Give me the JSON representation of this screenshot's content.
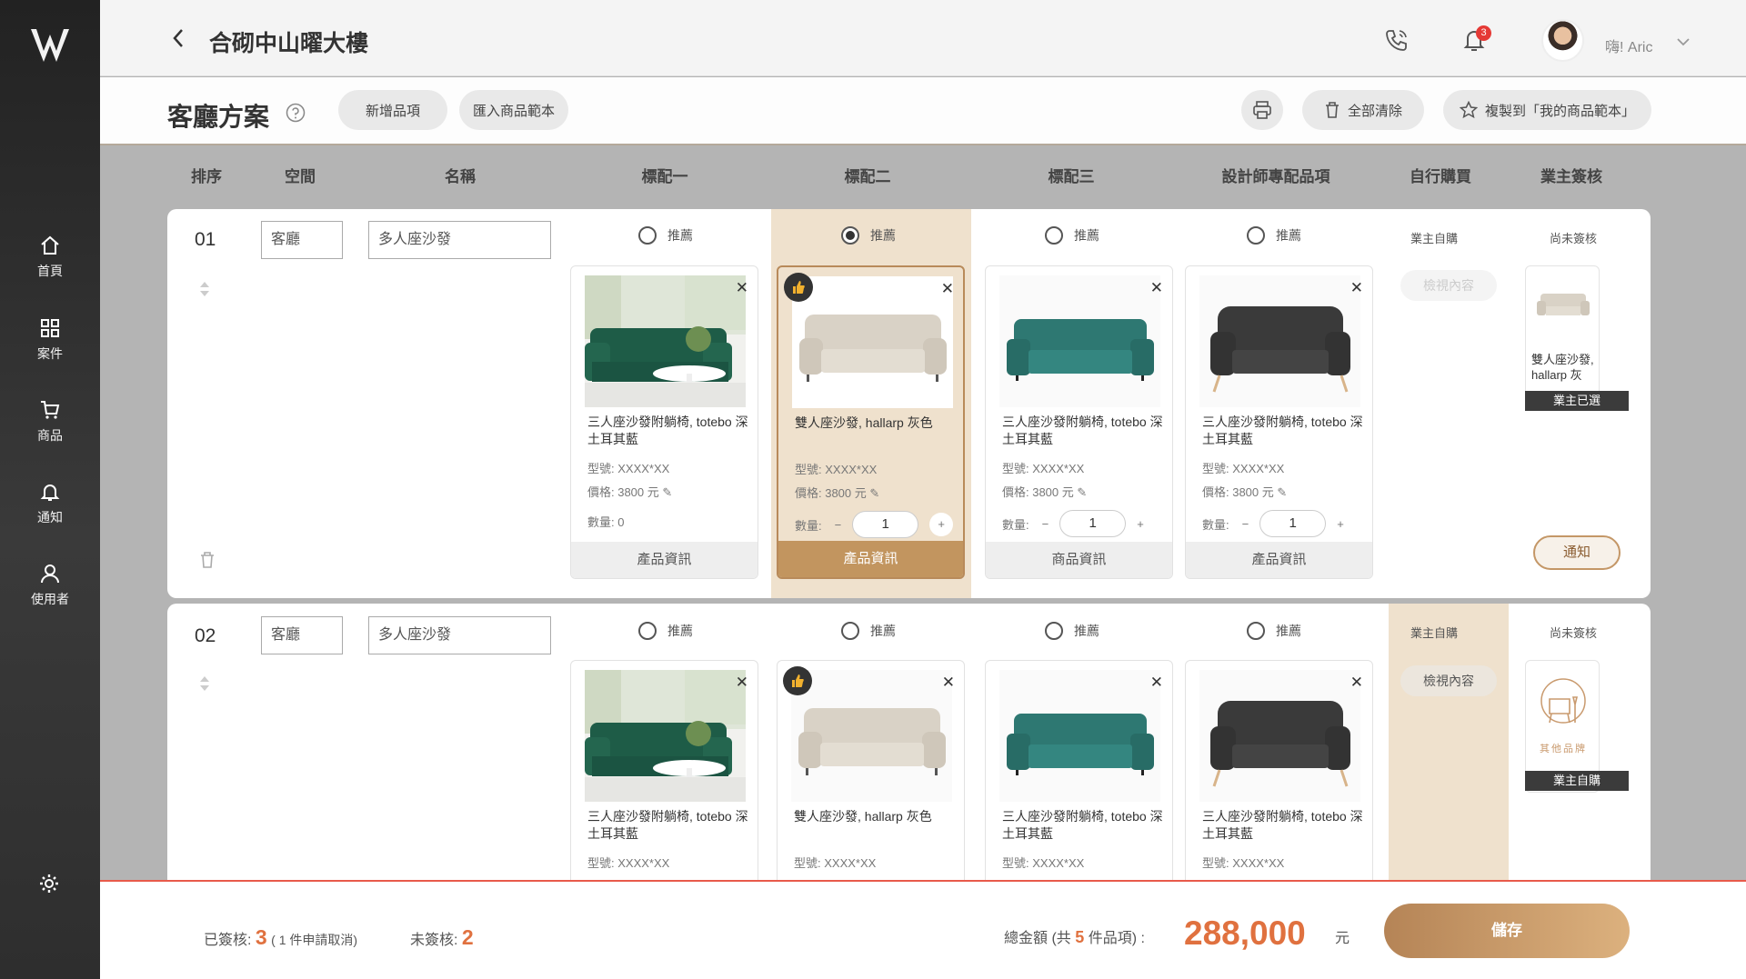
{
  "header": {
    "project_title": "合砌中山曜大樓",
    "greeting": "嗨! Aric",
    "notification_count": "3"
  },
  "nav": {
    "items": [
      {
        "label": "首頁",
        "icon": "home-icon"
      },
      {
        "label": "案件",
        "icon": "grid-icon"
      },
      {
        "label": "商品",
        "icon": "cart-icon"
      },
      {
        "label": "通知",
        "icon": "bell-icon"
      },
      {
        "label": "使用者",
        "icon": "user-icon"
      }
    ]
  },
  "toolbar": {
    "page_title": "客廳方案",
    "add_item": "新增品項",
    "import_template": "匯入商品範本",
    "clear_all": "全部清除",
    "copy_template": "複製到「我的商品範本」"
  },
  "columns": [
    "排序",
    "空間",
    "名稱",
    "標配一",
    "標配二",
    "標配三",
    "設計師專配品項",
    "自行購買",
    "業主簽核"
  ],
  "rows": [
    {
      "index": "01",
      "space": "客廳",
      "name": "多人座沙發",
      "self_buy": "業主自購",
      "view_content": "檢視內容",
      "approval": "尚未簽核",
      "owner_card_name": "雙人座沙發, hallarp 灰色...",
      "owner_tag": "業主已選",
      "notify_label": "通知",
      "products": [
        {
          "recommend": "推薦",
          "name": "三人座沙發附躺椅, totebo 深土耳其藍",
          "model": "型號: XXXX*XX",
          "price": "價格: 3800 元",
          "qty_label": "數量:",
          "qty": "0",
          "footer": "產品資訊"
        },
        {
          "recommend": "推薦",
          "name": "雙人座沙發, hallarp 灰色",
          "model": "型號: XXXX*XX",
          "price": "價格: 3800 元",
          "qty_label": "數量:",
          "qty": "1",
          "footer": "產品資訊"
        },
        {
          "recommend": "推薦",
          "name": "三人座沙發附躺椅, totebo 深土耳其藍",
          "model": "型號: XXXX*XX",
          "price": "價格: 3800 元",
          "qty_label": "數量:",
          "qty": "1",
          "footer": "商品資訊"
        },
        {
          "recommend": "推薦",
          "name": "三人座沙發附躺椅, totebo 深土耳其藍",
          "model": "型號: XXXX*XX",
          "price": "價格: 3800 元",
          "qty_label": "數量:",
          "qty": "1",
          "footer": "產品資訊"
        }
      ]
    },
    {
      "index": "02",
      "space": "客廳",
      "name": "多人座沙發",
      "self_buy": "業主自購",
      "view_content": "檢視內容",
      "approval": "尚未簽核",
      "other_brand": "其他品牌",
      "owner_tag": "業主自購",
      "products": [
        {
          "recommend": "推薦",
          "name": "三人座沙發附躺椅, totebo 深土耳其藍",
          "model": "型號: XXXX*XX"
        },
        {
          "recommend": "推薦",
          "name": "雙人座沙發, hallarp 灰色",
          "model": "型號: XXXX*XX"
        },
        {
          "recommend": "推薦",
          "name": "三人座沙發附躺椅, totebo 深土耳其藍",
          "model": "型號: XXXX*XX"
        },
        {
          "recommend": "推薦",
          "name": "三人座沙發附躺椅, totebo 深土耳其藍",
          "model": "型號: XXXX*XX"
        }
      ]
    }
  ],
  "footer": {
    "signed_label": "已簽核:",
    "signed_count": "3",
    "cancel_note": "( 1 件申請取消)",
    "unsigned_label": "未簽核:",
    "unsigned_count": "2",
    "total_prefix": "總金額 (共",
    "item_count": "5",
    "total_suffix": "件品項) :",
    "total_amount": "288,000",
    "currency": "元",
    "save": "儲存"
  },
  "colors": {
    "accent": "#c2955f",
    "highlight": "#efe1cd",
    "total": "#e0713f"
  }
}
